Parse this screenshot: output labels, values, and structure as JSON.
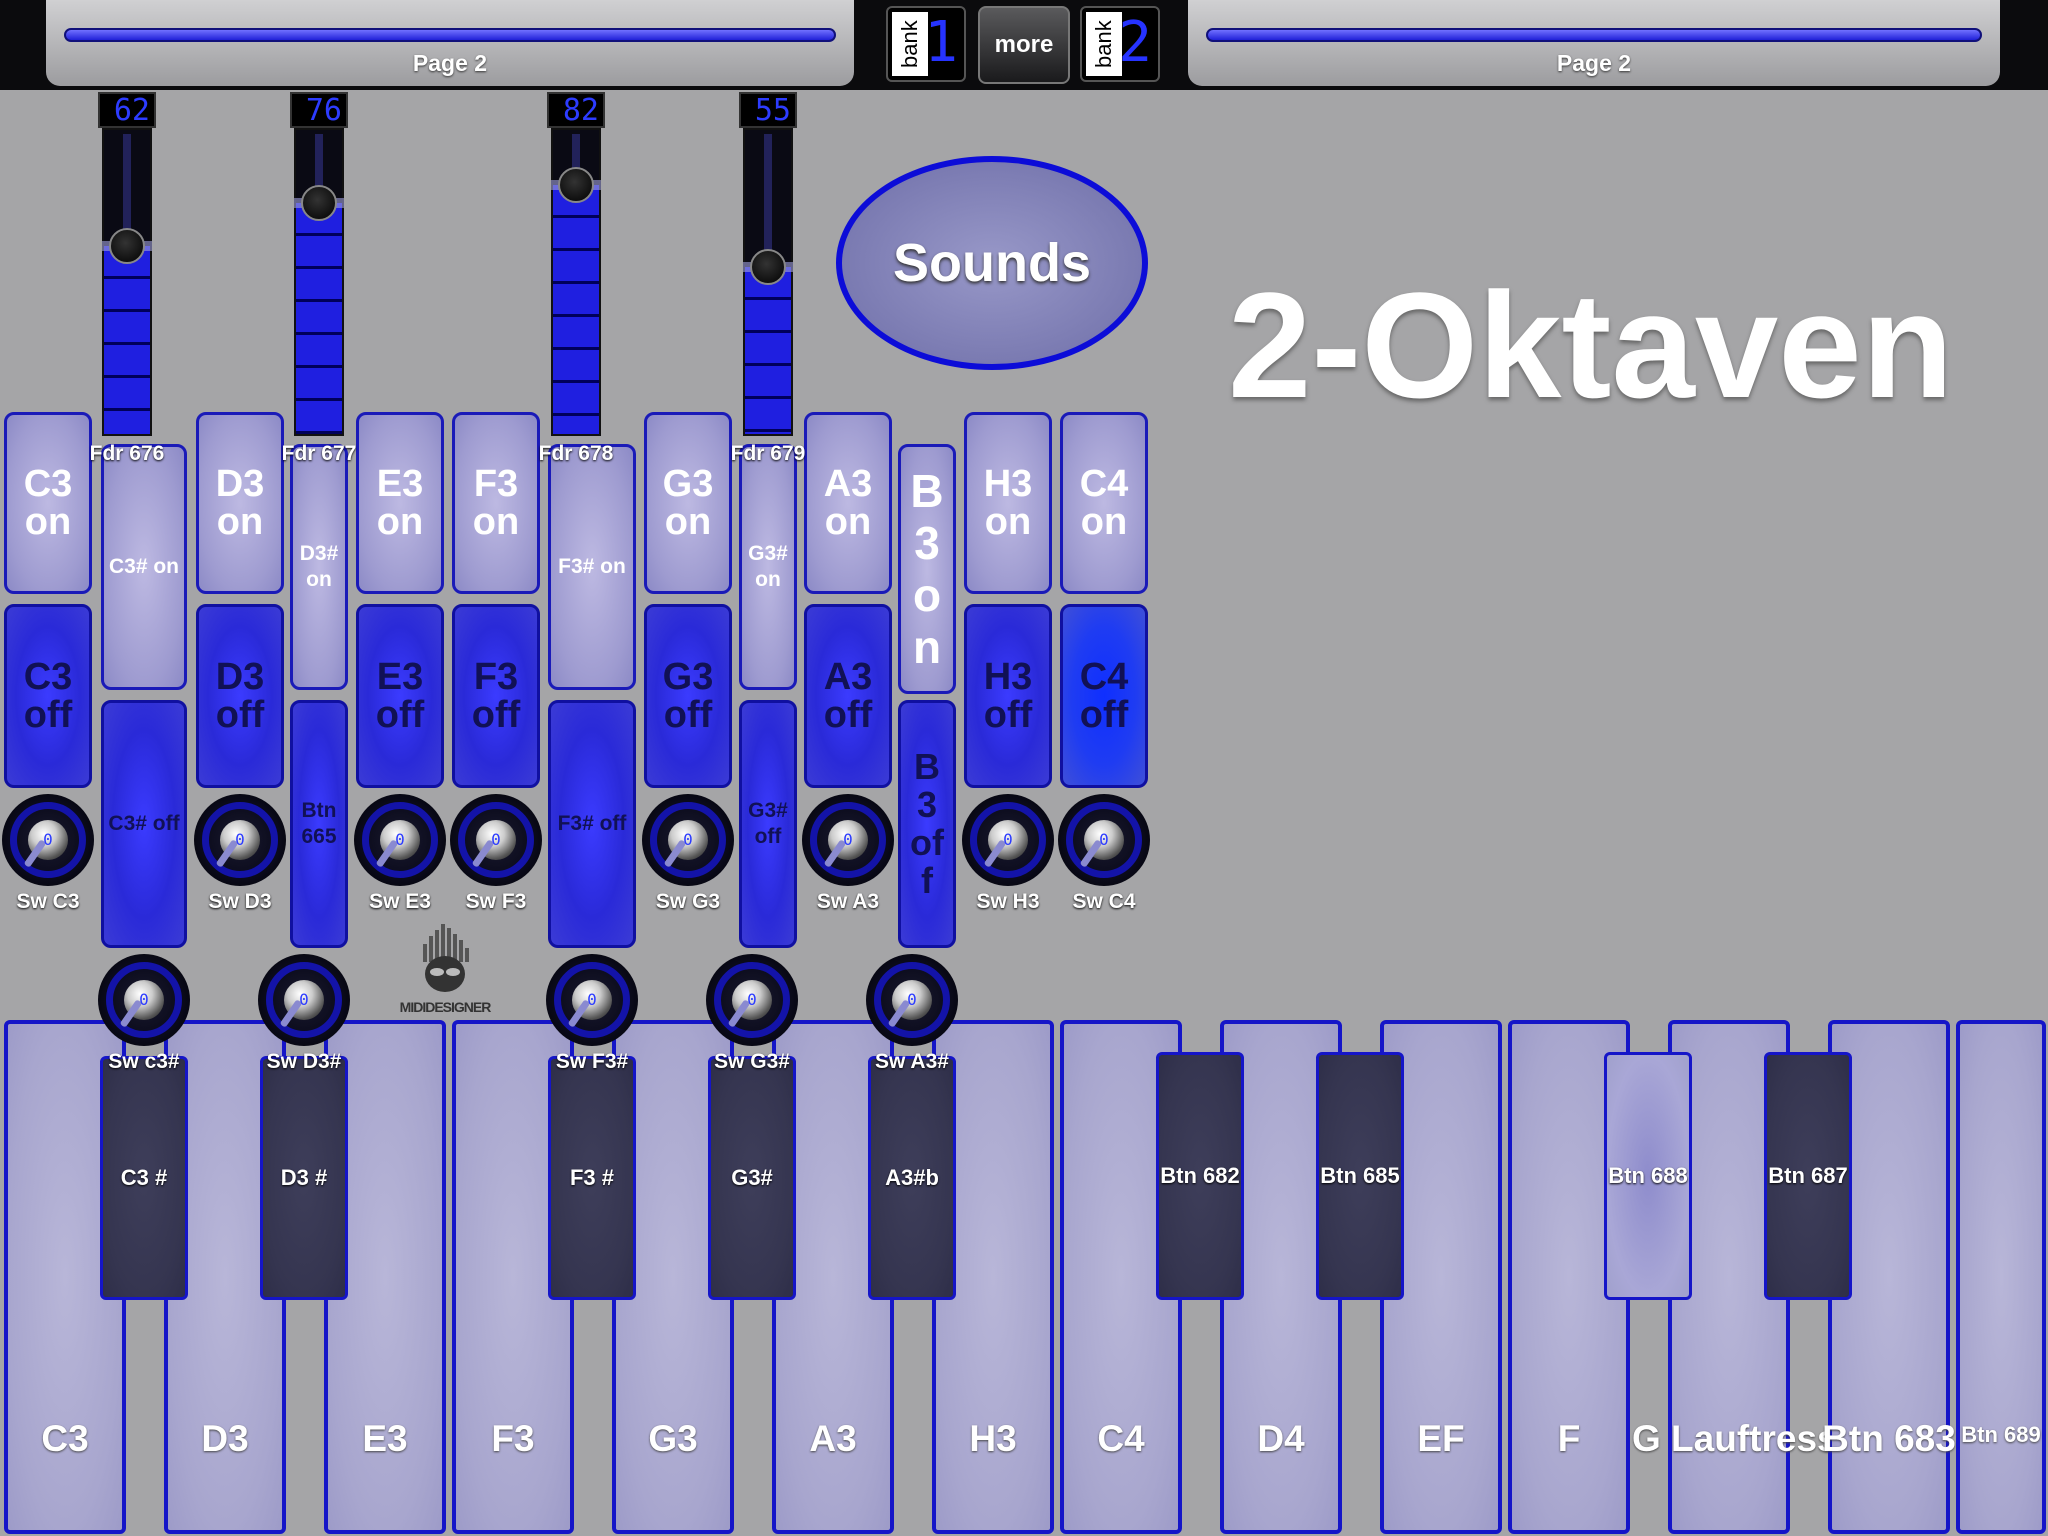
{
  "topbar": {
    "left_page": "Page 2",
    "right_page": "Page 2",
    "bank_left": {
      "label": "bank",
      "number": "1"
    },
    "bank_right": {
      "label": "bank",
      "number": "2"
    },
    "more": "more"
  },
  "faders": [
    {
      "value": "62",
      "label": "Fdr 676",
      "level": 0.62
    },
    {
      "value": "76",
      "label": "Fdr 677",
      "level": 0.76
    },
    {
      "value": "82",
      "label": "Fdr 678",
      "level": 0.82
    },
    {
      "value": "55",
      "label": "Fdr 679",
      "level": 0.55
    }
  ],
  "sounds_button": "Sounds",
  "title": "2-Oktaven",
  "on_buttons": [
    "C3 on",
    "D3 on",
    "E3 on",
    "F3 on",
    "G3 on",
    "A3 on",
    "H3 on",
    "C4 on"
  ],
  "off_buttons": [
    "C3 off",
    "D3 off",
    "E3 off",
    "F3 off",
    "G3 off",
    "A3 off",
    "H3 off",
    "C4 off"
  ],
  "sharp_on": [
    "C3# on",
    "D3# on",
    "F3# on",
    "G3# on"
  ],
  "sharp_off": [
    "C3# off",
    "Btn 665",
    "F3# off",
    "G3# off"
  ],
  "b3_on": "B3on",
  "b3_off": "B3off",
  "knobs_row1": [
    {
      "label": "Sw C3",
      "value": "0"
    },
    {
      "label": "Sw D3",
      "value": "0"
    },
    {
      "label": "Sw E3",
      "value": "0"
    },
    {
      "label": "Sw F3",
      "value": "0"
    },
    {
      "label": "Sw G3",
      "value": "0"
    },
    {
      "label": "Sw A3",
      "value": "0"
    },
    {
      "label": "Sw H3",
      "value": "0"
    },
    {
      "label": "Sw C4",
      "value": "0"
    }
  ],
  "knobs_row2": [
    {
      "label": "Sw c3#",
      "value": "0"
    },
    {
      "label": "Sw D3#",
      "value": "0"
    },
    {
      "label": "Sw F3#",
      "value": "0"
    },
    {
      "label": "Sw G3#",
      "value": "0"
    },
    {
      "label": "Sw A3#",
      "value": "0"
    }
  ],
  "logo_text": "MIDIDESIGNER",
  "white_keys": [
    "C3",
    "D3",
    "E3",
    "F3",
    "G3",
    "A3",
    "H3",
    "C4",
    "D4",
    "EF",
    "F",
    "G Lauftress",
    "Btn 683",
    "Btn 689"
  ],
  "black_keys": [
    "C3 #",
    "D3 #",
    "F3 #",
    "G3#",
    "A3#b",
    "Btn 682",
    "Btn 685",
    "Btn 688",
    "Btn 687"
  ],
  "colors": {
    "accent": "#1a1ab8",
    "background": "#a5a5a7",
    "display": "#2d3cff"
  }
}
